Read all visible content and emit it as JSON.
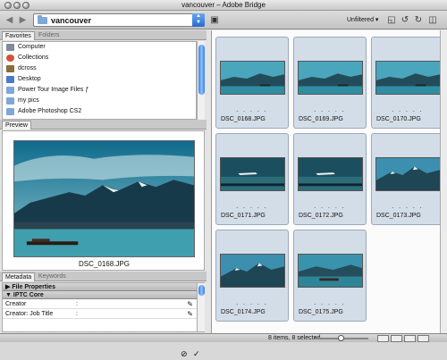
{
  "window": {
    "title": "vancouver – Adobe Bridge"
  },
  "toolbar": {
    "back_icon": "back-arrow-icon",
    "forward_icon": "forward-arrow-icon",
    "path": "vancouver",
    "filter": "Unfiltered",
    "icons": [
      "new-folder-icon",
      "rotate-left-icon",
      "rotate-right-icon",
      "trash-icon",
      "delete-icon"
    ]
  },
  "left": {
    "tabs": [
      "Favorites",
      "Folders"
    ],
    "favorites": [
      {
        "label": "Computer",
        "icon": "computer-icon",
        "color": "#7f8c9a"
      },
      {
        "label": "Collections",
        "icon": "collections-icon",
        "color": "#d0523a"
      },
      {
        "label": "dcross",
        "icon": "home-icon",
        "color": "#8a6d3a"
      },
      {
        "label": "Desktop",
        "icon": "desktop-icon",
        "color": "#4b7ac9"
      },
      {
        "label": "Power Tour Image Files ƒ",
        "icon": "folder-icon",
        "color": "#7fa7d8"
      },
      {
        "label": "my pics",
        "icon": "folder-icon",
        "color": "#7fa7d8"
      },
      {
        "label": "Adobe Photoshop CS2",
        "icon": "folder-icon",
        "color": "#7fa7d8"
      }
    ],
    "preview_tab": "Preview",
    "preview_caption": "DSC_0168.JPG",
    "meta_tabs": [
      "Metadata",
      "Keywords"
    ],
    "meta_sections": [
      "File Properties",
      "IPTC Core"
    ],
    "meta_rows": [
      {
        "label": "Creator",
        "value": ":"
      },
      {
        "label": "Creator: Job Title",
        "value": ":"
      }
    ]
  },
  "thumbnails": [
    {
      "name": "DSC_0168.JPG",
      "scene": "mountains"
    },
    {
      "name": "DSC_0169.JPG",
      "scene": "mountains"
    },
    {
      "name": "DSC_0170.JPG",
      "scene": "mountains"
    },
    {
      "name": "DSC_0171.JPG",
      "scene": "plane"
    },
    {
      "name": "DSC_0172.JPG",
      "scene": "plane"
    },
    {
      "name": "DSC_0173.JPG",
      "scene": "peaks"
    },
    {
      "name": "DSC_0174.JPG",
      "scene": "peaks"
    },
    {
      "name": "DSC_0175.JPG",
      "scene": "boat"
    }
  ],
  "thumb_rating": ". . . . .",
  "status": {
    "text": "8 items, 8 selected"
  }
}
